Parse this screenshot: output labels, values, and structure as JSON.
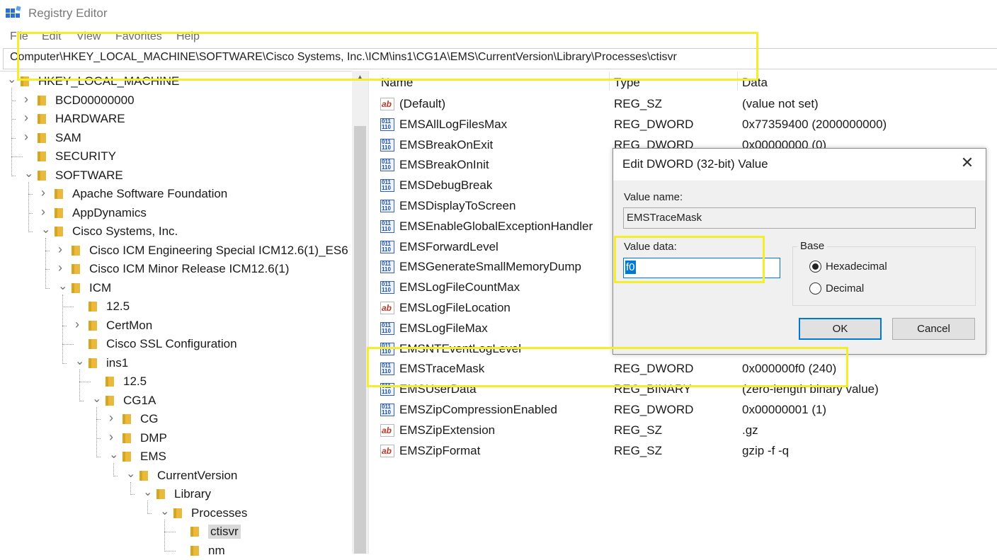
{
  "window": {
    "title": "Registry Editor",
    "icon": "registry-editor-icon"
  },
  "menu": [
    "File",
    "Edit",
    "View",
    "Favorites",
    "Help"
  ],
  "address": "Computer\\HKEY_LOCAL_MACHINE\\SOFTWARE\\Cisco Systems, Inc.\\ICM\\ins1\\CG1A\\EMS\\CurrentVersion\\Library\\Processes\\ctisvr",
  "tree": [
    {
      "label": "HKEY_LOCAL_MACHINE",
      "state": "expanded"
    },
    {
      "label": "BCD00000000",
      "state": "collapsed"
    },
    {
      "label": "HARDWARE",
      "state": "collapsed"
    },
    {
      "label": "SAM",
      "state": "collapsed"
    },
    {
      "label": "SECURITY",
      "state": "leaf"
    },
    {
      "label": "SOFTWARE",
      "state": "expanded"
    },
    {
      "label": "Apache Software Foundation",
      "state": "collapsed"
    },
    {
      "label": "AppDynamics",
      "state": "collapsed"
    },
    {
      "label": "Cisco Systems, Inc.",
      "state": "expanded"
    },
    {
      "label": "Cisco ICM Engineering Special ICM12.6(1)_ES6",
      "state": "collapsed"
    },
    {
      "label": "Cisco ICM Minor Release ICM12.6(1)",
      "state": "collapsed"
    },
    {
      "label": "ICM",
      "state": "expanded"
    },
    {
      "label": "12.5",
      "state": "leaf"
    },
    {
      "label": "CertMon",
      "state": "collapsed"
    },
    {
      "label": "Cisco SSL Configuration",
      "state": "leaf"
    },
    {
      "label": "ins1",
      "state": "expanded"
    },
    {
      "label": "12.5",
      "state": "leaf"
    },
    {
      "label": "CG1A",
      "state": "expanded"
    },
    {
      "label": "CG",
      "state": "collapsed"
    },
    {
      "label": "DMP",
      "state": "collapsed"
    },
    {
      "label": "EMS",
      "state": "expanded"
    },
    {
      "label": "CurrentVersion",
      "state": "expanded"
    },
    {
      "label": "Library",
      "state": "expanded"
    },
    {
      "label": "Processes",
      "state": "expanded"
    },
    {
      "label": "ctisvr",
      "state": "selected"
    },
    {
      "label": "nm",
      "state": "leaf"
    }
  ],
  "list": {
    "headers": {
      "name": "Name",
      "type": "Type",
      "data": "Data"
    },
    "rows": [
      {
        "name": "(Default)",
        "type": "REG_SZ",
        "data": "(value not set)",
        "icon": "string-value-icon"
      },
      {
        "name": "EMSAllLogFilesMax",
        "type": "REG_DWORD",
        "data": "0x77359400 (2000000000)",
        "icon": "dword-value-icon"
      },
      {
        "name": "EMSBreakOnExit",
        "type": "REG_DWORD",
        "data": "0x00000000 (0)",
        "icon": "dword-value-icon"
      },
      {
        "name": "EMSBreakOnInit",
        "type": "",
        "data": "",
        "icon": "dword-value-icon"
      },
      {
        "name": "EMSDebugBreak",
        "type": "",
        "data": "",
        "icon": "dword-value-icon"
      },
      {
        "name": "EMSDisplayToScreen",
        "type": "",
        "data": "",
        "icon": "dword-value-icon"
      },
      {
        "name": "EMSEnableGlobalExceptionHandler",
        "type": "",
        "data": "",
        "icon": "dword-value-icon"
      },
      {
        "name": "EMSForwardLevel",
        "type": "",
        "data": "",
        "icon": "dword-value-icon"
      },
      {
        "name": "EMSGenerateSmallMemoryDump",
        "type": "",
        "data": "",
        "icon": "dword-value-icon"
      },
      {
        "name": "EMSLogFileCountMax",
        "type": "",
        "data": "",
        "icon": "dword-value-icon"
      },
      {
        "name": "EMSLogFileLocation",
        "type": "",
        "data": "",
        "icon": "string-value-icon"
      },
      {
        "name": "EMSLogFileMax",
        "type": "",
        "data": "",
        "icon": "dword-value-icon"
      },
      {
        "name": "EMSNTEventLogLevel",
        "type": "",
        "data": "",
        "icon": "dword-value-icon"
      },
      {
        "name": "EMSTraceMask",
        "type": "REG_DWORD",
        "data": "0x000000f0 (240)",
        "icon": "dword-value-icon"
      },
      {
        "name": "EMSUserData",
        "type": "REG_BINARY",
        "data": "(zero-length binary value)",
        "icon": "binary-value-icon"
      },
      {
        "name": "EMSZipCompressionEnabled",
        "type": "REG_DWORD",
        "data": "0x00000001 (1)",
        "icon": "dword-value-icon"
      },
      {
        "name": "EMSZipExtension",
        "type": "REG_SZ",
        "data": ".gz",
        "icon": "string-value-icon"
      },
      {
        "name": "EMSZipFormat",
        "type": "REG_SZ",
        "data": "gzip -f -q",
        "icon": "string-value-icon"
      }
    ]
  },
  "dialog": {
    "title": "Edit DWORD (32-bit) Value",
    "value_name_label": "Value name:",
    "value_name": "EMSTraceMask",
    "value_data_label": "Value data:",
    "value_data": "f0",
    "base_label": "Base",
    "hex_label": "Hexadecimal",
    "dec_label": "Decimal",
    "base_selected": "Hexadecimal",
    "ok_label": "OK",
    "cancel_label": "Cancel",
    "close_glyph": "✕"
  },
  "colors": {
    "highlight": "#f2ee2b",
    "accent": "#0078d7",
    "folder": "#e8b93c"
  }
}
